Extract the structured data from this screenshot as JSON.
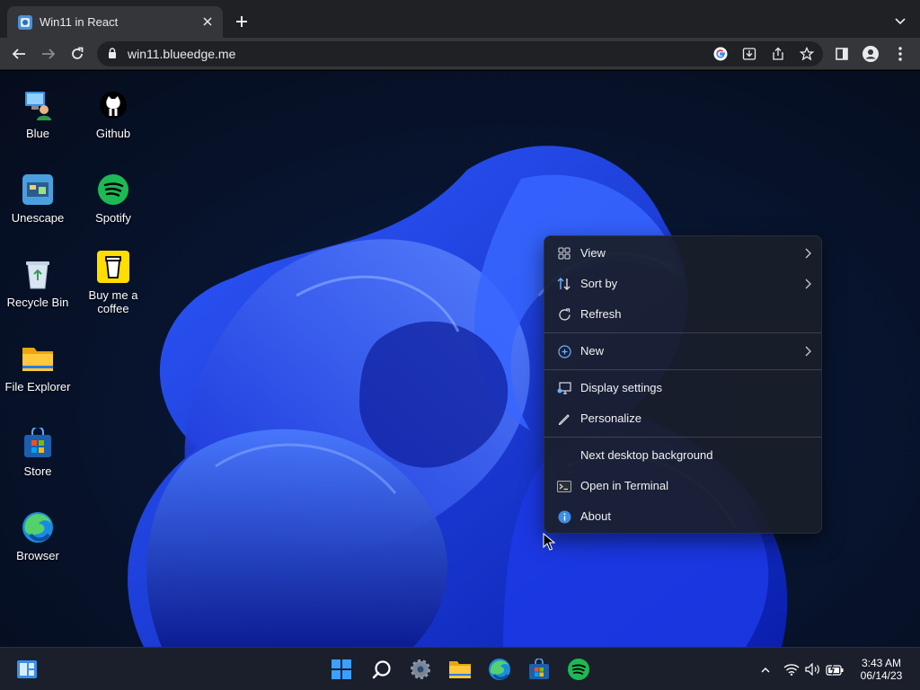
{
  "browser": {
    "tab_title": "Win11 in React",
    "url": "win11.blueedge.me"
  },
  "desktop_icons": [
    {
      "label": "Blue",
      "icon": "user-computer-icon"
    },
    {
      "label": "Github",
      "icon": "github-icon"
    },
    {
      "label": "Unescape",
      "icon": "unescape-app-icon"
    },
    {
      "label": "Spotify",
      "icon": "spotify-icon"
    },
    {
      "label": "Recycle Bin",
      "icon": "recycle-bin-icon"
    },
    {
      "label": "Buy me a coffee",
      "icon": "coffee-cup-icon"
    },
    {
      "label": "File Explorer",
      "icon": "folder-icon"
    },
    {
      "label": "Store",
      "icon": "store-icon"
    },
    {
      "label": "Browser",
      "icon": "edge-browser-icon"
    }
  ],
  "context_menu": {
    "items": [
      {
        "label": "View",
        "icon": "grid-icon",
        "submenu": true
      },
      {
        "label": "Sort by",
        "icon": "sort-arrows-icon",
        "submenu": true
      },
      {
        "label": "Refresh",
        "icon": "refresh-icon",
        "submenu": false
      },
      {
        "label": "New",
        "icon": "plus-circle-icon",
        "submenu": true
      },
      {
        "label": "Display settings",
        "icon": "display-icon",
        "submenu": false
      },
      {
        "label": "Personalize",
        "icon": "pen-icon",
        "submenu": false
      },
      {
        "label": "Next desktop background",
        "icon": "",
        "submenu": false
      },
      {
        "label": "Open in Terminal",
        "icon": "terminal-icon",
        "submenu": false
      },
      {
        "label": "About",
        "icon": "info-icon",
        "submenu": false
      }
    ]
  },
  "taskbar": {
    "apps": [
      "widgets-icon",
      "start-icon",
      "search-icon",
      "settings-icon",
      "file-explorer-icon",
      "edge-icon",
      "store-icon",
      "spotify-icon"
    ],
    "tray": [
      "chevron-up-icon",
      "wifi-icon",
      "volume-icon",
      "battery-icon"
    ],
    "time": "3:43 AM",
    "date": "06/14/23"
  },
  "colors": {
    "accent": "#0078d4",
    "spotify": "#1db954",
    "info": "#3a8ee6"
  }
}
